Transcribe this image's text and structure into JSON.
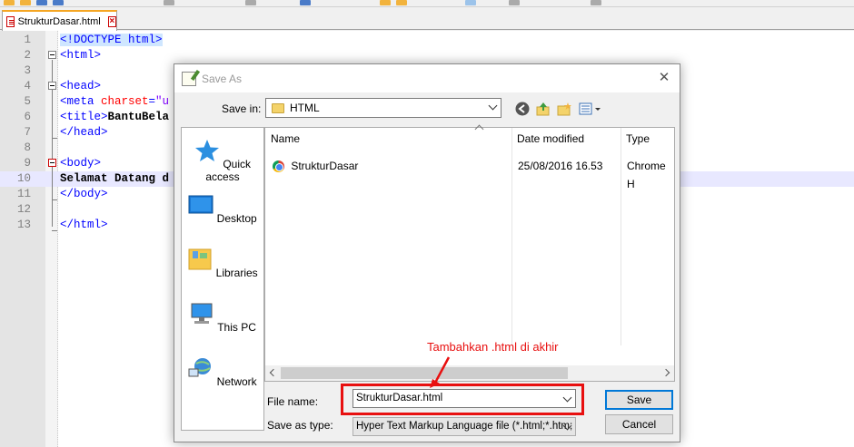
{
  "editor": {
    "tab_label": "StrukturDasar.html",
    "lines": [
      {
        "n": "1",
        "parts": [
          [
            "tag",
            "<!DOCTYPE html>"
          ]
        ]
      },
      {
        "n": "2",
        "parts": [
          [
            "tag",
            "<html>"
          ]
        ]
      },
      {
        "n": "3",
        "parts": []
      },
      {
        "n": "4",
        "parts": [
          [
            "tag",
            "<head>"
          ]
        ]
      },
      {
        "n": "5",
        "parts": [
          [
            "tag",
            "<meta "
          ],
          [
            "attr",
            "charset"
          ],
          [
            "tag",
            "="
          ],
          [
            "str",
            "\"u"
          ]
        ]
      },
      {
        "n": "6",
        "parts": [
          [
            "tag",
            "<title>"
          ],
          [
            "txt",
            "BantuBela"
          ]
        ]
      },
      {
        "n": "7",
        "parts": [
          [
            "tag",
            "</head>"
          ]
        ]
      },
      {
        "n": "8",
        "parts": []
      },
      {
        "n": "9",
        "parts": [
          [
            "tag",
            "<body>"
          ]
        ]
      },
      {
        "n": "10",
        "parts": [
          [
            "txt",
            "Selamat Datang d"
          ]
        ]
      },
      {
        "n": "11",
        "parts": [
          [
            "tag",
            "</body>"
          ]
        ]
      },
      {
        "n": "12",
        "parts": []
      },
      {
        "n": "13",
        "parts": [
          [
            "tag",
            "</html>"
          ]
        ]
      }
    ]
  },
  "dialog": {
    "title": "Save As",
    "save_in_label": "Save in:",
    "save_in_value": "HTML",
    "places": [
      "Quick access",
      "Desktop",
      "Libraries",
      "This PC",
      "Network"
    ],
    "columns": [
      "Name",
      "Date modified",
      "Type"
    ],
    "files": [
      {
        "name": "StrukturDasar",
        "date": "25/08/2016 16.53",
        "type": "Chrome H"
      }
    ],
    "file_name_label": "File name:",
    "file_name_value": "StrukturDasar.html",
    "save_type_label": "Save as type:",
    "save_type_value": "Hyper Text Markup Language file (*.html;*.htm;",
    "save_button": "Save",
    "cancel_button": "Cancel"
  },
  "annotation": {
    "text": "Tambahkan .html di akhir",
    "color": "#e81010"
  }
}
